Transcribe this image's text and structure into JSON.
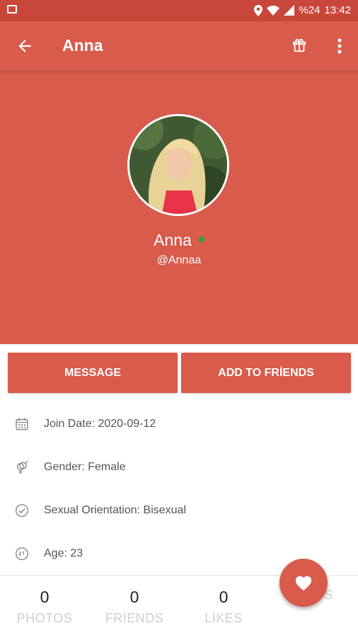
{
  "status_bar": {
    "battery": "%24",
    "time": "13:42",
    "icons": [
      "image-icon",
      "location-icon",
      "wifi-icon",
      "signal-icon"
    ]
  },
  "app_bar": {
    "title": "Anna",
    "icons": [
      "back-arrow-icon",
      "gift-icon",
      "more-vertical-icon"
    ]
  },
  "profile": {
    "name": "Anna",
    "username": "@Annaa",
    "online": true
  },
  "actions": {
    "message_label": "MESSAGE",
    "add_friend_label": "ADD TO FRİENDS"
  },
  "info": [
    {
      "icon": "calendar-icon",
      "text": "Join Date: 2020-09-12"
    },
    {
      "icon": "gender-icon",
      "text": "Gender: Female"
    },
    {
      "icon": "check-circle-icon",
      "text": "Sexual Orientation: Bisexual"
    },
    {
      "icon": "age-icon",
      "text": "Age: 23"
    }
  ],
  "stats": [
    {
      "value": "0",
      "label": "PHOTOS"
    },
    {
      "value": "0",
      "label": "FRİENDS"
    },
    {
      "value": "0",
      "label": "LİKES"
    },
    {
      "value": "",
      "label": "GİFTS"
    }
  ],
  "fab": {
    "icon": "heart-icon"
  },
  "colors": {
    "primary": "#d85b4b",
    "status_bar": "#c9473a",
    "online": "#2ea043"
  }
}
